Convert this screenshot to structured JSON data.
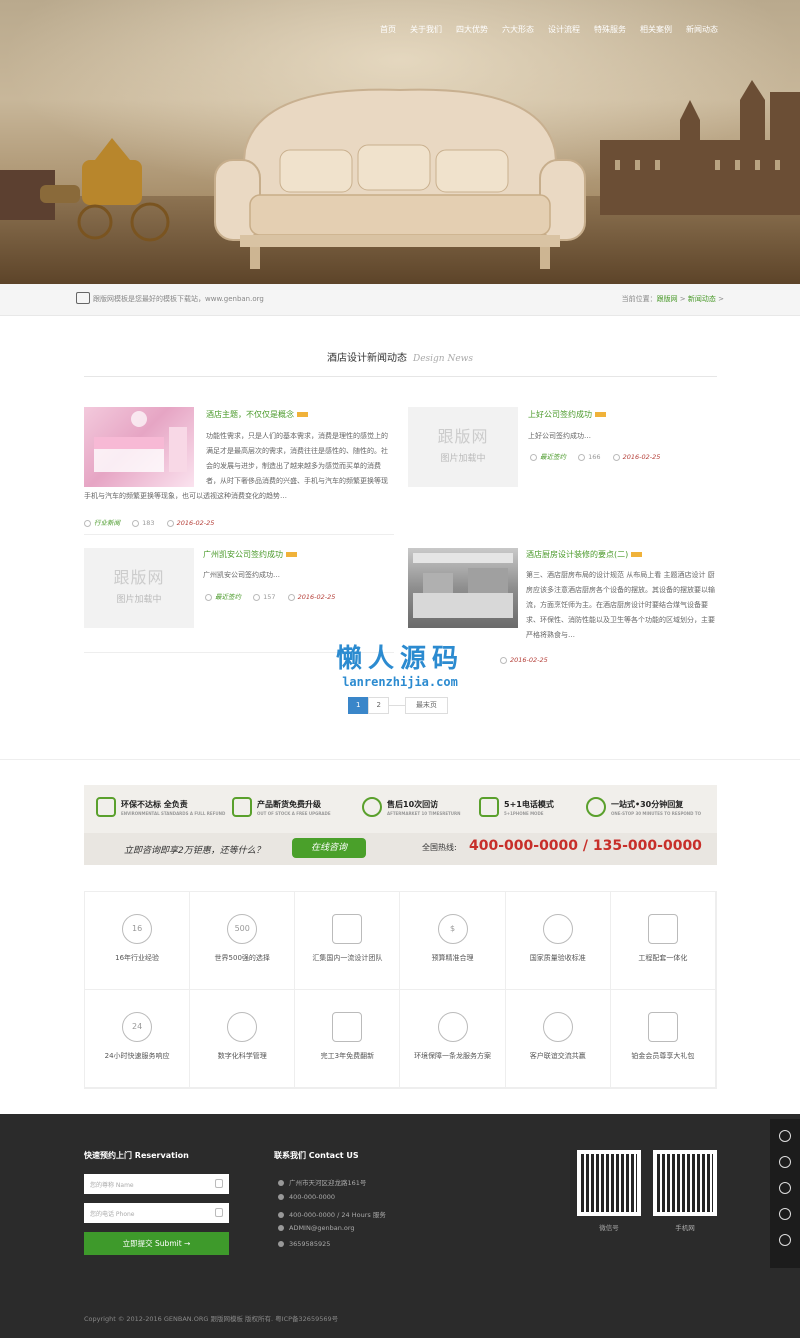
{
  "nav": [
    "首页",
    "关于我们",
    "四大优势",
    "六大形态",
    "设计流程",
    "特殊服务",
    "相关案例",
    "新闻动态"
  ],
  "bar": {
    "tip": "跟版网模板是您最好的模板下载站，www.genban.org",
    "crumb_prefix": "当前位置：",
    "crumb_home": "跟版网",
    "crumb_sep": " > ",
    "crumb_current": "新闻动态",
    "crumb_end": " >"
  },
  "section": {
    "title": "酒店设计新闻动态",
    "subtitle": "Design News"
  },
  "placeholder": {
    "big": "跟版网",
    "small": "图片加载中"
  },
  "news": [
    {
      "title": "酒店主题，不仅仅是概念",
      "desc": "功能性需求，只是人们的基本需求，消费是理性的感觉上的满足才是最高层次的需求，消费往往是感性的、随性的。社会的发展与进步，制造出了越来越多为感觉而买单的消费者，从时下奢侈品消费的兴盛、手机与汽车的频繁更换等现象，也可以透视这种消费变化的趋势…",
      "cat": "行业新闻",
      "views": "183",
      "date": "2016-02-25"
    },
    {
      "title": "上好公司签约成功",
      "desc": "上好公司签约成功…",
      "cat": "最近签约",
      "views": "166",
      "date": "2016-02-25"
    },
    {
      "title": "广州凯安公司签约成功",
      "desc": "广州凯安公司签约成功…",
      "cat": "最近签约",
      "views": "157",
      "date": "2016-02-25"
    },
    {
      "title": "酒店厨房设计装修的要点(二)",
      "desc": "第三、酒店厨房布局的设计规范 从布局上看 主题酒店设计 厨房应该多注意酒店厨房各个设备的摆放。其设备的摆放要以输流，方面烹饪师为主。在酒店厨房设计时要结合煤气设备要求、环保性、消防性能以及卫生等各个功能的区域划分，主要严格将熟食与…",
      "cat": "",
      "views": "",
      "date": "2016-02-25"
    }
  ],
  "watermark": {
    "cn": "懒人源码",
    "en": "lanrenzhijia.com"
  },
  "pager": {
    "p1": "1",
    "p2": "2",
    "last": "最末页"
  },
  "banner": {
    "features": [
      {
        "t": "环保不达标 全负责",
        "s": "ENVIRONMENTAL STANDARDS A FULL REFUND"
      },
      {
        "t": "产品断货免费升级",
        "s": "OUT OF STOCK A FREE UPGRADE"
      },
      {
        "t": "售后10次回访",
        "s": "AFTERMARKET 10 TIMESRETURN"
      },
      {
        "t": "5+1电话模式",
        "s": "5+1PHONE MODE"
      },
      {
        "t": "一站式•30分钟回复",
        "s": "ONE-STOP 30 MINUTES TO RESPOND TO"
      }
    ],
    "cta": "立即咨询即享2万钜惠，还等什么？",
    "button": "在线咨询",
    "hotline_label": "全国热线:",
    "phones": "400-000-0000  /  135-000-0000"
  },
  "grid": [
    "16年行业经验",
    "世界500强的选择",
    "汇集国内一流设计团队",
    "预算精准合理",
    "国家质量验收标准",
    "工程配套一体化",
    "24小时快速服务响应",
    "数字化科学管理",
    "完工3年免费翻新",
    "环境保障一条龙服务方案",
    "客户联谊交流共赢",
    "铂金会员尊享大礼包"
  ],
  "grid_icons": [
    "16",
    "500",
    "",
    "$",
    "",
    "",
    "24",
    "",
    "",
    "",
    "",
    ""
  ],
  "footer": {
    "reserve_title": "快速预约上门 Reservation",
    "name_ph": "您的尊称 Name",
    "phone_ph": "您的电话 Phone",
    "submit": "立即提交 Submit →",
    "contact_title": "联系我们 Contact US",
    "address": "广州市天河区迎龙路161号",
    "tel": "400-000-0000",
    "hours": "400-000-0000   / 24 Hours 服务",
    "email": "ADMIN@genban.org",
    "qq": "3659585925",
    "qr1": "微信号",
    "qr2": "手机网",
    "copyright": "Copyright © 2012-2016 GENBAN.ORG 跟版网模板 版权所有. 粤ICP备32659569号"
  }
}
